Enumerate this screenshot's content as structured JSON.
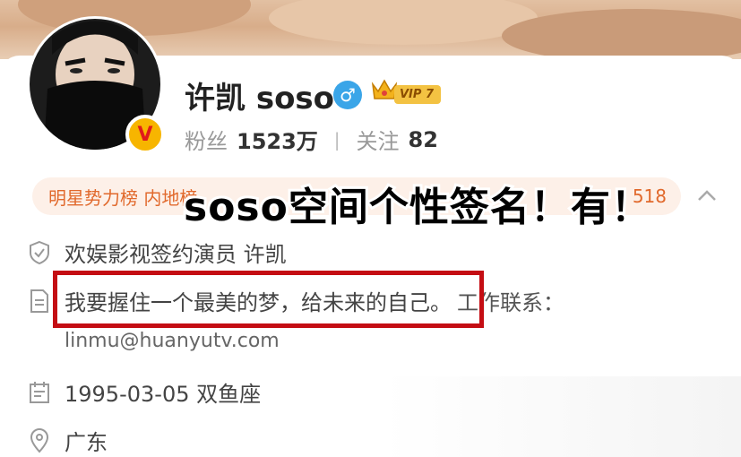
{
  "profile": {
    "name": "许凯 soso",
    "verified_badge": "V",
    "gender_symbol": "♂",
    "vip_label": "VIP 7",
    "fans_label": "粉丝",
    "fans_count": "1523万",
    "follow_label": "关注",
    "follow_count": "82"
  },
  "rank_bar": {
    "text": "明星势力榜 内地榜",
    "number": "518"
  },
  "overlay_caption": "soso空间个性签名！有！",
  "info": {
    "occupation": "欢娱影视签约演员 许凯",
    "bio": "我要握住一个最美的梦，给未来的自己。",
    "bio_tail": "工作联系：",
    "email": "linmu@huanyutv.com",
    "birthday": "1995-03-05 双鱼座",
    "location": "广东"
  },
  "colors": {
    "accent_orange": "#e1692c",
    "highlight_red": "#c40d13",
    "gender_blue": "#3aa5e8",
    "vip_gold": "#f3c242"
  },
  "icons": [
    "verified-v-icon",
    "male-gender-icon",
    "crown-icon",
    "chevron-up-icon",
    "shield-icon",
    "document-icon",
    "calendar-icon",
    "location-pin-icon"
  ]
}
